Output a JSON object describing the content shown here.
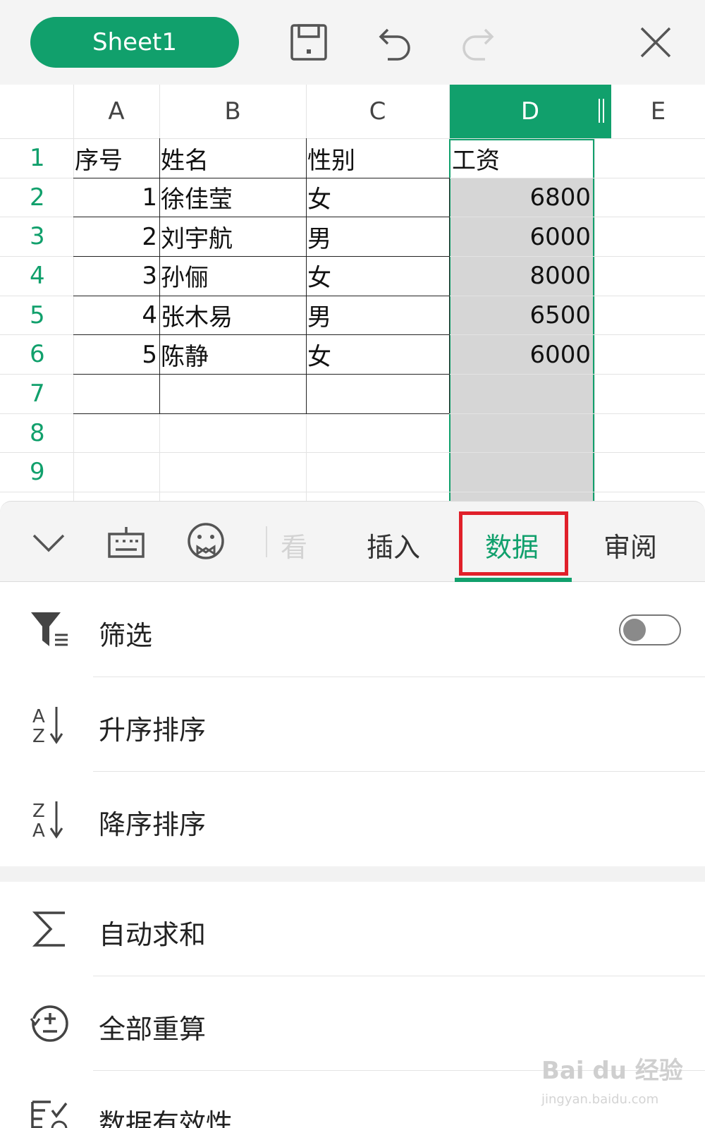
{
  "toolbar": {
    "sheet_label": "Sheet1",
    "icons": [
      "save-icon",
      "undo-icon",
      "redo-icon",
      "close-icon"
    ]
  },
  "grid": {
    "columns": [
      "A",
      "B",
      "C",
      "D",
      "E"
    ],
    "selected_column": "D",
    "rows": [
      "1",
      "2",
      "3",
      "4",
      "5",
      "6",
      "7",
      "8",
      "9"
    ],
    "cells": [
      [
        "序号",
        "姓名",
        "性别",
        "工资"
      ],
      [
        "1",
        "徐佳莹",
        "女",
        "6800"
      ],
      [
        "2",
        "刘宇航",
        "男",
        "6000"
      ],
      [
        "3",
        "孙俪",
        "女",
        "8000"
      ],
      [
        "4",
        "张木易",
        "男",
        "6500"
      ],
      [
        "5",
        "陈静",
        "女",
        "6000"
      ]
    ],
    "accent": "#11a06c"
  },
  "tabs": {
    "partial_label": "看",
    "items": [
      "插入",
      "数据",
      "审阅"
    ],
    "active": "数据",
    "highlight_color": "#e0202a"
  },
  "menu": {
    "filter": {
      "label": "筛选",
      "toggle_on": false
    },
    "sort_asc": {
      "label": "升序排序"
    },
    "sort_desc": {
      "label": "降序排序"
    },
    "autosum": {
      "label": "自动求和"
    },
    "recalc": {
      "label": "全部重算"
    },
    "validation": {
      "label": "数据有效性"
    }
  },
  "watermark": {
    "brand": "Bai du 经验",
    "url": "jingyan.baidu.com"
  }
}
